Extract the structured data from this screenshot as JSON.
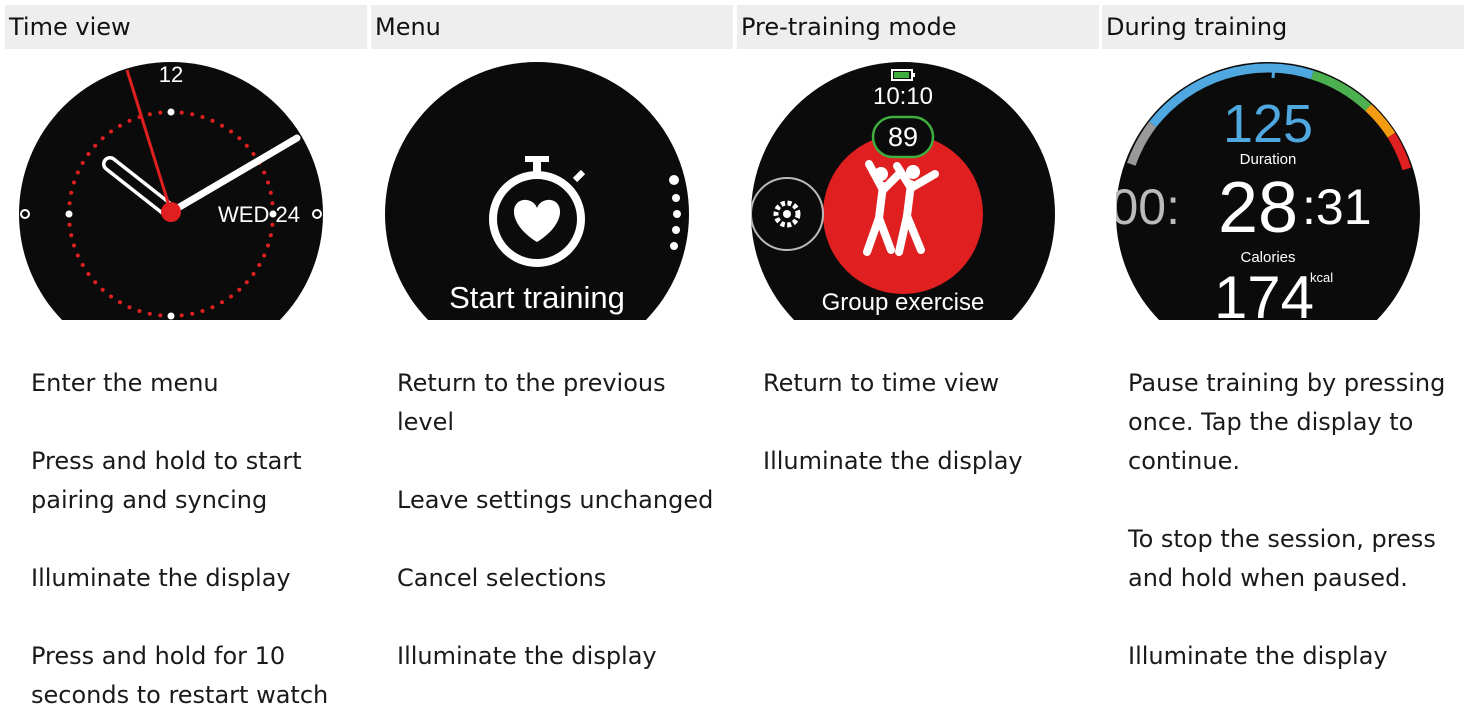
{
  "columns": [
    {
      "header": "Time view",
      "watch": {
        "hour_label": "12",
        "date_label": "WED 24"
      },
      "descriptions": [
        "Enter the menu",
        "Press and hold to start pairing and syncing",
        "Illuminate the display",
        "Press and hold for 10 seconds to restart watch"
      ]
    },
    {
      "header": "Menu",
      "watch": {
        "label": "Start training"
      },
      "descriptions": [
        "Return to the previous level",
        "Leave settings unchanged",
        "Cancel selections",
        "Illuminate the display"
      ]
    },
    {
      "header": "Pre-training mode",
      "watch": {
        "time": "10:10",
        "heart_rate": "89",
        "sport": "Group exercise"
      },
      "descriptions": [
        "Return to time view",
        "Illuminate the display"
      ]
    },
    {
      "header": "During training",
      "watch": {
        "heart_rate": "125",
        "duration_label": "Duration",
        "duration_hours": "00:",
        "duration_minutes": "28",
        "duration_seconds": ":31",
        "calories_label": "Calories",
        "calories_value": "174",
        "calories_unit": "kcal"
      },
      "descriptions": [
        "Pause training by pressing once. Tap the display to continue.",
        "To stop the session, press and hold when paused.",
        "Illuminate the display"
      ]
    }
  ],
  "colors": {
    "header_bg": "#eeeeee",
    "watch_face": "#0b0b0b",
    "accent_red": "#e02020",
    "hr_blue": "#4fa8e0",
    "zone_green": "#4caf50",
    "zone_orange": "#f39c12",
    "battery_green": "#3fae3f"
  }
}
